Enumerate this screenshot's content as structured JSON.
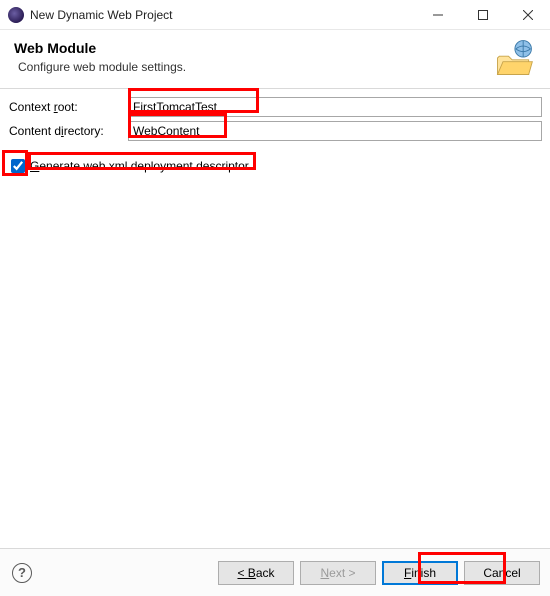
{
  "titlebar": {
    "title": "New Dynamic Web Project"
  },
  "header": {
    "title": "Web Module",
    "subtitle": "Configure web module settings."
  },
  "form": {
    "context_root": {
      "label_pre": "Context ",
      "label_mn": "r",
      "label_post": "oot:",
      "value": "FirstTomcatTest"
    },
    "content_dir": {
      "label_pre": "Content d",
      "label_mn": "i",
      "label_post": "rectory:",
      "value": "WebContent"
    },
    "gen_webxml": {
      "checked": true,
      "label_mn": "G",
      "label_rest": "enerate web.xml deployment descriptor"
    }
  },
  "buttons": {
    "back": "< Back",
    "next": "Next >",
    "finish": "Finish",
    "cancel": "Cancel"
  }
}
